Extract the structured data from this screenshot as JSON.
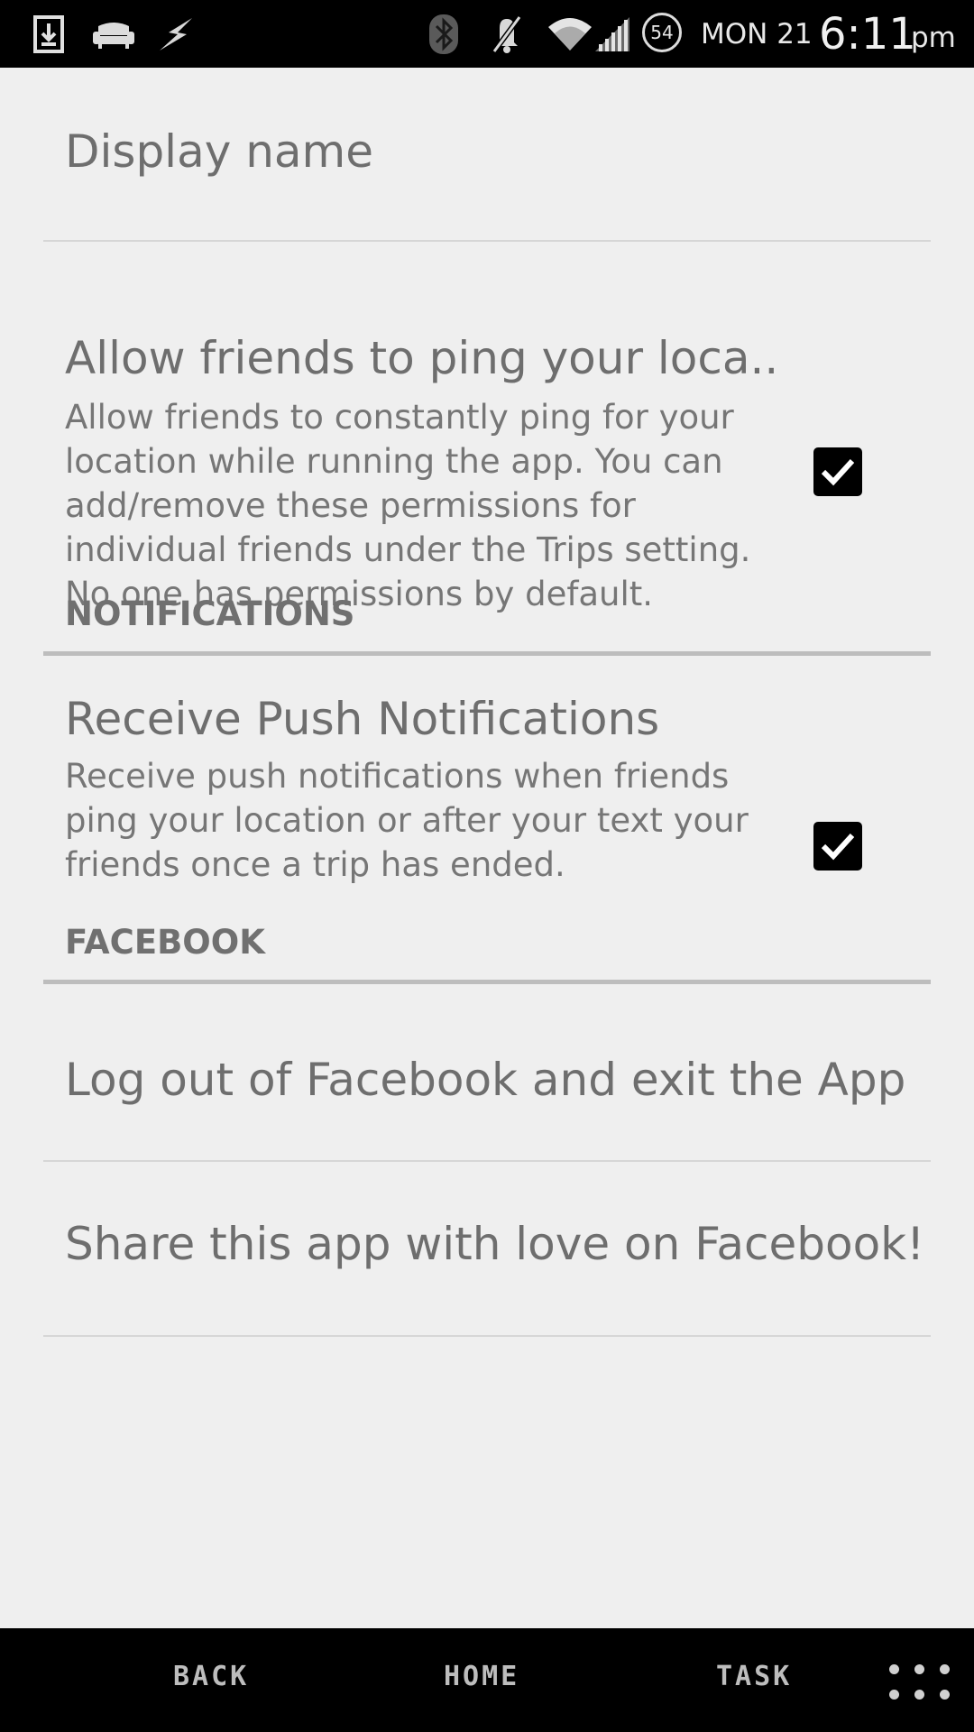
{
  "status_bar": {
    "icons": [
      "download-icon",
      "sofa-icon",
      "lightning-icon",
      "bluetooth-icon",
      "mute-icon",
      "wifi-icon",
      "signal-icon"
    ],
    "battery_level": "54",
    "date": "MON 21",
    "time": "6:11",
    "ampm": "pm"
  },
  "settings": {
    "display_name": {
      "title": "Display name"
    },
    "ping_location": {
      "title": "Allow friends to ping your loca..",
      "summary": "Allow friends to constantly ping for your location while running the app. You can add/remove these permissions for individual friends under the Trips setting. No one has permissions by default.",
      "checked": true
    },
    "notifications_header": "NOTIFICATIONS",
    "push_notifications": {
      "title": "Receive Push Notifications",
      "summary": "Receive push notifications when friends ping your location or after your text your friends once a trip has ended.",
      "checked": true
    },
    "facebook_header": "FACEBOOK",
    "logout": {
      "title": "Log out of Facebook and exit the App"
    },
    "share": {
      "title": "Share this app with love on Facebook!"
    }
  },
  "nav_bar": {
    "back": "BACK",
    "home": "HOME",
    "task": "TASK"
  },
  "colors": {
    "background": "#efefef",
    "bars": "#000000",
    "text": "#6e6e6e",
    "checkbox": "#000000"
  }
}
